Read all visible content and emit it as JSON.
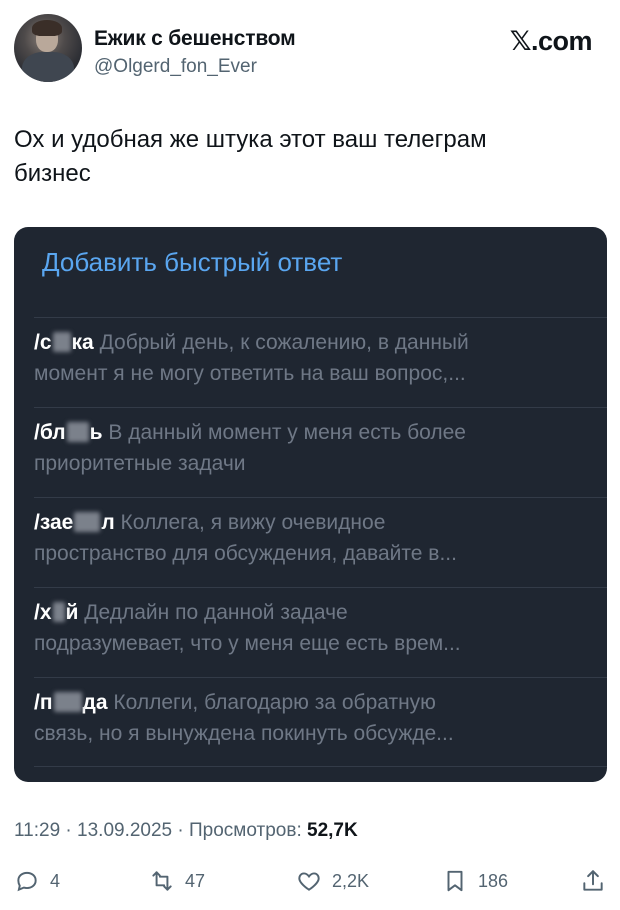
{
  "author": {
    "name": "Ежик с бешенством",
    "handle": "@Olgerd_fon_Ever"
  },
  "brand": "𝕏.com",
  "tweet": {
    "line1": "Ох и удобная же штука этот ваш телеграм",
    "line2": "бизнес"
  },
  "quick_replies": {
    "title": "Добавить быстрый ответ",
    "items": [
      {
        "cmd_a": "/с",
        "cmd_b": "ка",
        "line1": "Добрый день, к сожалению, в данный",
        "line2": "момент я не могу ответить на ваш вопрос,..."
      },
      {
        "cmd_a": "/бл",
        "cmd_b": "ь",
        "line1": "В данный момент у меня есть более",
        "line2": "приоритетные задачи"
      },
      {
        "cmd_a": "/зае",
        "cmd_b": "л",
        "line1": "Коллега, я вижу очевидное",
        "line2": "пространство для обсуждения, давайте в..."
      },
      {
        "cmd_a": "/х",
        "cmd_b": "й",
        "line1": "Дедлайн по данной задаче",
        "line2": "подразумевает, что у меня еще есть врем..."
      },
      {
        "cmd_a": "/п",
        "cmd_b": "да",
        "line1": "Коллеги, благодарю за обратную",
        "line2": "связь, но я вынуждена покинуть обсужде..."
      }
    ]
  },
  "meta": {
    "time": "11:29",
    "sep1": "·",
    "date": "13.09.2025",
    "sep2": "·",
    "views_label": "Просмотров:",
    "views_count": "52,7K"
  },
  "actions": {
    "replies": "4",
    "reposts": "47",
    "likes": "2,2K",
    "bookmarks": "186"
  },
  "icons": [
    "reply-icon",
    "repost-icon",
    "like-icon",
    "bookmark-icon",
    "share-icon"
  ],
  "colors": {
    "accent": "#5aa6f0",
    "panel": "#1f2631",
    "text_secondary": "#536471"
  }
}
